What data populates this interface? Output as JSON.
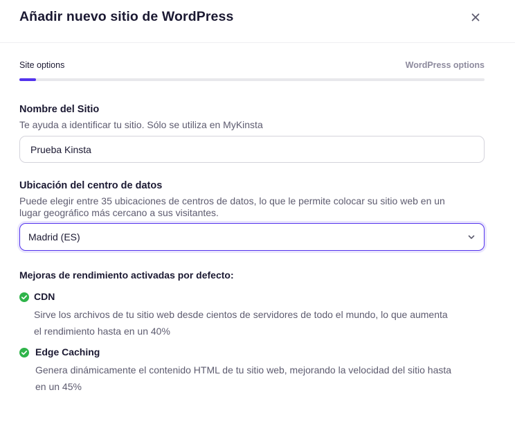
{
  "dialog": {
    "title": "Añadir nuevo sitio de WordPress",
    "close_icon": "close-icon"
  },
  "steps": {
    "items": [
      {
        "label": "Site options",
        "active": true
      },
      {
        "label": "WordPress options",
        "active": false
      }
    ],
    "progress_percent": 3.5,
    "accent_color": "#5333ed"
  },
  "site_name": {
    "label": "Nombre del Sitio",
    "hint": "Te ayuda a identificar tu sitio. Sólo se utiliza en MyKinsta",
    "value": "Prueba Kinsta"
  },
  "datacenter": {
    "label": "Ubicación del centro de datos",
    "hint_line1": "Puede elegir entre 35 ubicaciones de centros de datos, lo que le permite colocar su sitio web en un",
    "hint_line2": "lugar geográfico más cercano a sus visitantes.",
    "selected": "Madrid (ES)",
    "chevron_icon": "chevron-down-icon"
  },
  "performance": {
    "title": "Mejoras de rendimiento activadas por defecto:",
    "check_color": "#2fb44a",
    "features": [
      {
        "name": "CDN",
        "desc_line1": "Sirve los archivos de tu sitio web desde cientos de servidores de todo el mundo, lo que aumenta",
        "desc_line2": "el rendimiento hasta en un 40%"
      },
      {
        "name": "Edge Caching",
        "desc_line1": "Genera dinámicamente el contenido HTML de tu sitio web, mejorando la velocidad del sitio hasta",
        "desc_line2": "en un 45%"
      }
    ]
  }
}
